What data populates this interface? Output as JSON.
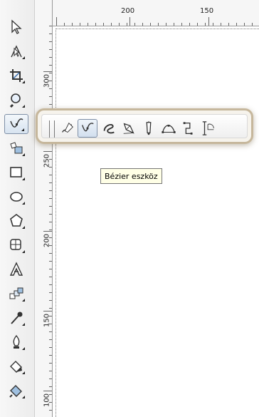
{
  "rulers": {
    "horizontal": {
      "labels": [
        "200",
        "150"
      ]
    },
    "vertical": {
      "labels": [
        "300",
        "250",
        "200",
        "150",
        "100"
      ]
    }
  },
  "toolbox": {
    "tools": [
      {
        "name": "pick-tool",
        "icon": "arrow-pointer-icon"
      },
      {
        "name": "shape-tool",
        "icon": "shape-node-icon"
      },
      {
        "name": "crop-tool",
        "icon": "crop-icon"
      },
      {
        "name": "zoom-tool",
        "icon": "magnifier-icon"
      },
      {
        "name": "curve-tool",
        "icon": "bezier-curve-icon",
        "active": true
      },
      {
        "name": "smart-fill-tool",
        "icon": "smart-fill-icon"
      },
      {
        "name": "rectangle-tool",
        "icon": "rectangle-icon"
      },
      {
        "name": "ellipse-tool",
        "icon": "ellipse-icon"
      },
      {
        "name": "polygon-tool",
        "icon": "polygon-icon"
      },
      {
        "name": "basic-shapes-tool",
        "icon": "basic-shapes-icon"
      },
      {
        "name": "text-tool",
        "icon": "text-a-icon"
      },
      {
        "name": "interactive-blend-tool",
        "icon": "blend-icon"
      },
      {
        "name": "eyedropper-tool",
        "icon": "eyedropper-icon"
      },
      {
        "name": "outline-tool",
        "icon": "outline-pen-icon"
      },
      {
        "name": "fill-tool",
        "icon": "paint-bucket-icon"
      },
      {
        "name": "interactive-fill-tool",
        "icon": "interactive-fill-icon"
      }
    ]
  },
  "flyout": {
    "items": [
      {
        "name": "freehand-tool",
        "icon": "freehand-pencil-icon"
      },
      {
        "name": "bezier-tool",
        "icon": "bezier-node-icon",
        "active": true
      },
      {
        "name": "artistic-media-tool",
        "icon": "artistic-media-icon"
      },
      {
        "name": "pen-tool",
        "icon": "pen-nib-icon"
      },
      {
        "name": "polyline-tool",
        "icon": "polyline-icon"
      },
      {
        "name": "three-point-curve-tool",
        "icon": "three-point-curve-icon"
      },
      {
        "name": "connector-tool",
        "icon": "connector-icon"
      },
      {
        "name": "dimension-tool",
        "icon": "dimension-icon"
      }
    ]
  },
  "tooltip": {
    "text": "Bézier eszköz"
  }
}
